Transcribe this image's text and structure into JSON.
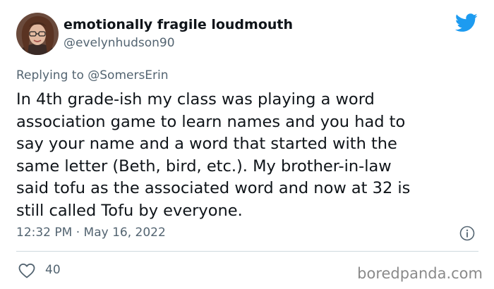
{
  "tweet": {
    "author": {
      "display_name": "emotionally fragile loudmouth",
      "handle": "@evelynhudson90",
      "avatar_icon": "avatar-photo"
    },
    "replying_prefix": "Replying to",
    "replying_to": "@SomersErin",
    "text_lines": [
      "In 4th grade-ish my class was playing a word",
      "association game to learn names and you had to",
      "say your name and a word that started with the",
      "same letter (Beth, bird, etc.). My brother-in-law",
      "said tofu as the associated word and now at 32 is",
      "still called Tofu by everyone."
    ],
    "timestamp": "12:32 PM · May 16, 2022",
    "likes_count": "40"
  },
  "icons": {
    "brand": "twitter-bird-icon",
    "info": "info-icon",
    "like": "heart-icon"
  },
  "watermark": "boredpanda.com",
  "colors": {
    "twitter_blue": "#1d9bf0",
    "text_primary": "#0f1419",
    "text_secondary": "#536471",
    "divider": "#cfd9de"
  }
}
